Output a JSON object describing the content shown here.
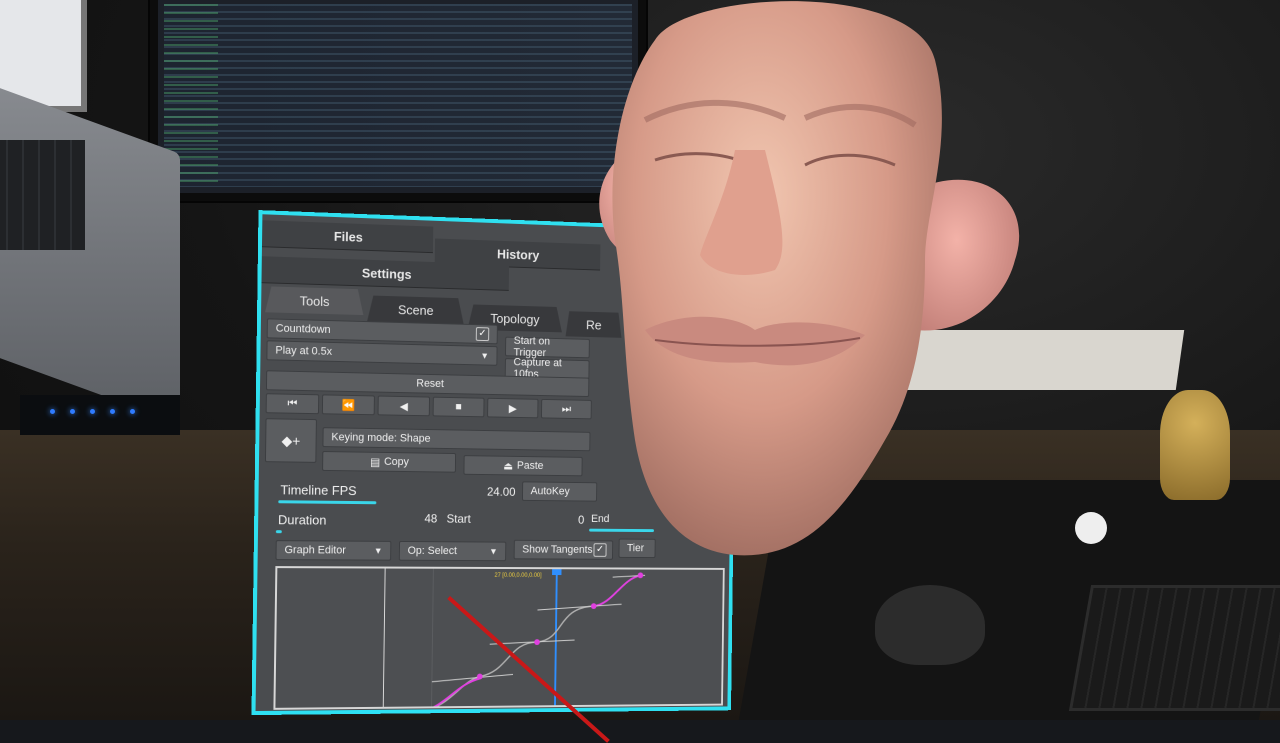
{
  "panel": {
    "top_tabs": {
      "files": "Files",
      "history": "History",
      "settings": "Settings"
    },
    "tabs": [
      "Tools",
      "Scene",
      "Topology",
      "Re"
    ],
    "controls": {
      "countdown": "Countdown",
      "countdown_checked": "✓",
      "start_on_trigger": "Start on Trigger",
      "play_speed": "Play at 0.5x",
      "capture": "Capture at 10fps",
      "reset": "Reset",
      "keying_mode": "Keying mode: Shape",
      "copy": "Copy",
      "paste": "Paste",
      "autokey": "AutoKey"
    },
    "transport": [
      "⏮",
      "⏪",
      "◀",
      "■",
      "▶",
      "⏭"
    ],
    "timeline_fps_label": "Timeline FPS",
    "timeline_fps_value": "24.00",
    "duration_label": "Duration",
    "duration_value": "48",
    "start_label": "Start",
    "start_value": "0",
    "end_label": "End",
    "graph_editor": "Graph Editor",
    "op_select": "Op: Select",
    "show_tangents": "Show Tangents",
    "show_tangents_checked": "✓",
    "tier": "Tier",
    "graph_readout": "27 [0.00,0.00,0.00]"
  },
  "colors": {
    "accent": "#2fe0f0",
    "curve_highlight": "#e040e0",
    "playhead": "#2f8fff",
    "pointer": "#c91818"
  }
}
